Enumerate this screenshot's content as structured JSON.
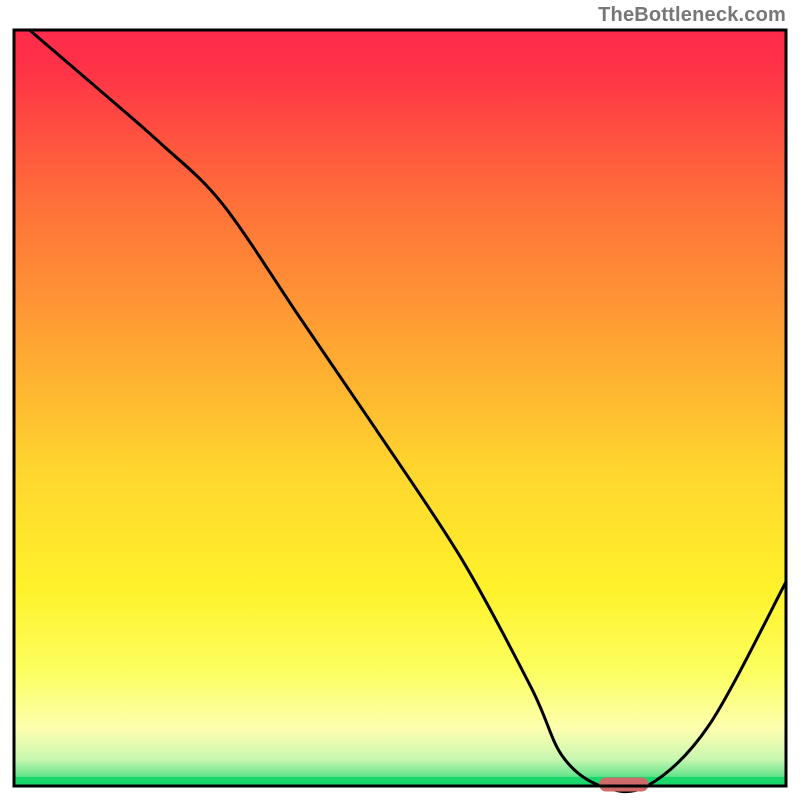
{
  "branding": {
    "watermark": "TheBottleneck.com"
  },
  "chart_data": {
    "type": "line",
    "title": "",
    "xlabel": "",
    "ylabel": "",
    "xlim": [
      0,
      100
    ],
    "ylim": [
      0,
      100
    ],
    "grid": false,
    "gradient_stops": [
      {
        "offset": 0,
        "color": "#ff2a4b"
      },
      {
        "offset": 0.05,
        "color": "#ff3247"
      },
      {
        "offset": 0.22,
        "color": "#ff6d3a"
      },
      {
        "offset": 0.4,
        "color": "#ffa033"
      },
      {
        "offset": 0.58,
        "color": "#ffd52e"
      },
      {
        "offset": 0.74,
        "color": "#fff22b"
      },
      {
        "offset": 0.85,
        "color": "#fcff60"
      },
      {
        "offset": 0.925,
        "color": "#fdffb0"
      },
      {
        "offset": 0.965,
        "color": "#c7f7b0"
      },
      {
        "offset": 0.985,
        "color": "#6fe58f"
      },
      {
        "offset": 1.0,
        "color": "#19d76a"
      }
    ],
    "series": [
      {
        "name": "bottleneck-curve",
        "x": [
          2,
          10,
          19,
          27,
          37,
          47,
          58,
          67,
          71,
          76,
          82,
          90,
          100
        ],
        "values": [
          100,
          93,
          85,
          77,
          62,
          47,
          30,
          13,
          4,
          0,
          0,
          8,
          27
        ]
      }
    ],
    "marker": {
      "x_center": 79,
      "x_halfwidth": 3.2,
      "y": 0.2,
      "color": "#d06a6a"
    }
  }
}
